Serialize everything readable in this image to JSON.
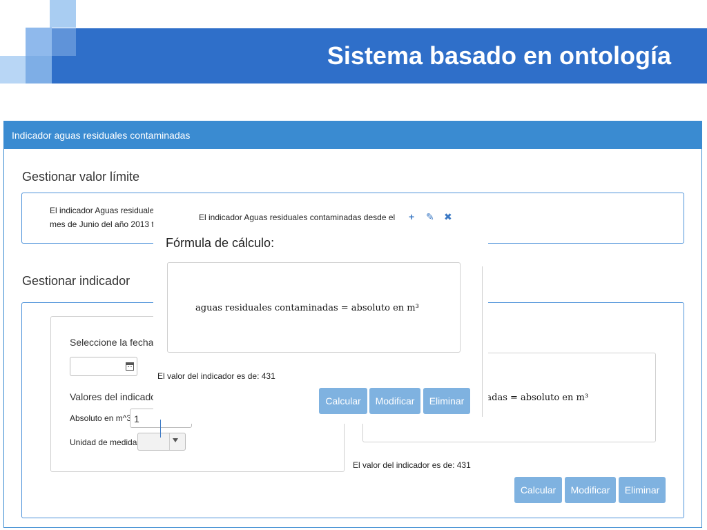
{
  "slide": {
    "title": "Sistema basado en ontología",
    "brand_color": "#2f6fc9"
  },
  "panel": {
    "header": "Indicador aguas residuales contaminadas",
    "header_color": "#3a8bd1"
  },
  "limit_section": {
    "title": "Gestionar valor límite",
    "text_line1": "El indicador Aguas residuales contamir",
    "text_line2": "mes de Junio del año 2013 tier"
  },
  "indicator_section": {
    "title": "Gestionar indicador",
    "date_label": "Seleccione la fecha:",
    "date_value": "",
    "values_label": "Valores del indicador:",
    "absolute_label": "Absoluto en m^3:",
    "absolute_value": "1",
    "unit_label": "Unidad de medida:",
    "unit_value": "",
    "formula_text": "nadas = absoluto en m³",
    "result_text": "El valor del indicador es de: 431",
    "buttons": {
      "calcular": "Calcular",
      "modificar": "Modificar",
      "eliminar": "Eliminar"
    }
  },
  "overlay": {
    "limit_text": "El indicador Aguas residuales contaminadas desde el",
    "title": "Fórmula de cálculo:",
    "formula_text": "aguas residuales contaminadas = absoluto en m³",
    "result_text": "El valor del indicador es de: 431",
    "buttons": {
      "calcular": "Calcular",
      "modificar": "Modificar",
      "eliminar": "Eliminar"
    },
    "action_icons": [
      "plus-icon",
      "edit-icon",
      "delete-icon"
    ]
  },
  "colors": {
    "button": "#7fb2e0",
    "accent": "#3a8bd1"
  }
}
